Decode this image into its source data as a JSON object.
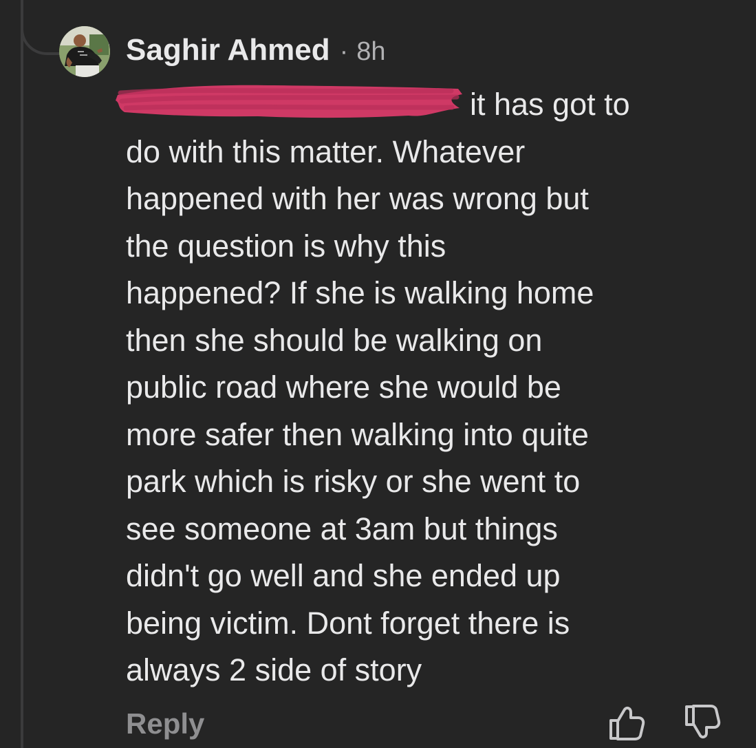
{
  "comment": {
    "author": "Saghir Ahmed",
    "separator": "·",
    "time": "8h",
    "body": "it has got to\ndo with this matter. Whatever\nhappened with her was wrong but\nthe question is why this\nhappened? If she is walking home\nthen she should be walking on\npublic road where she would be\nmore safer then walking into quite\npark which is risky or she went to\nsee someone at 3am but things\ndidn't go well and she ended up\nbeing victim.  Dont forget there is\nalways 2 side of story",
    "redaction_color": "#d63a68"
  },
  "actions": {
    "reply_label": "Reply",
    "like_icon": "thumbs-up-icon",
    "dislike_icon": "thumbs-down-icon"
  },
  "colors": {
    "background": "#252525",
    "text": "#e9e9ea",
    "muted": "#8f8f91"
  }
}
